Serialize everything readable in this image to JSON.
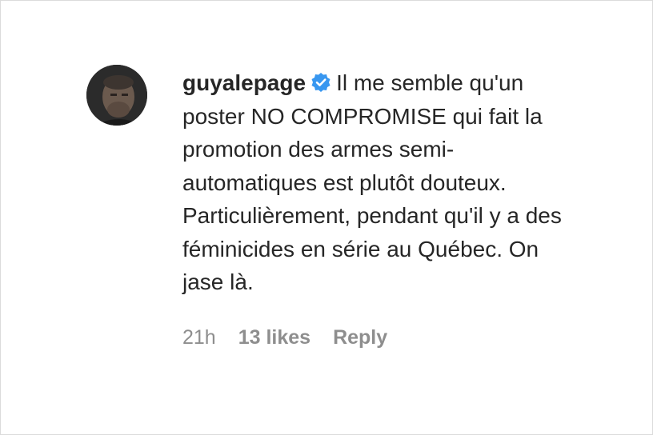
{
  "comment": {
    "username": "guyalepage",
    "verified_icon": "verified-badge-icon",
    "text": "Il me semble qu'un poster NO COMPROMISE qui fait la promotion des armes semi-automatiques est plutôt douteux. Particulièrement, pendant qu'il y a des féminicides en série au Québec. On jase là.",
    "time": "21h",
    "likes": "13 likes",
    "reply_label": "Reply"
  },
  "colors": {
    "text": "#262626",
    "meta": "#8e8e8e",
    "verified": "#3897f0"
  }
}
